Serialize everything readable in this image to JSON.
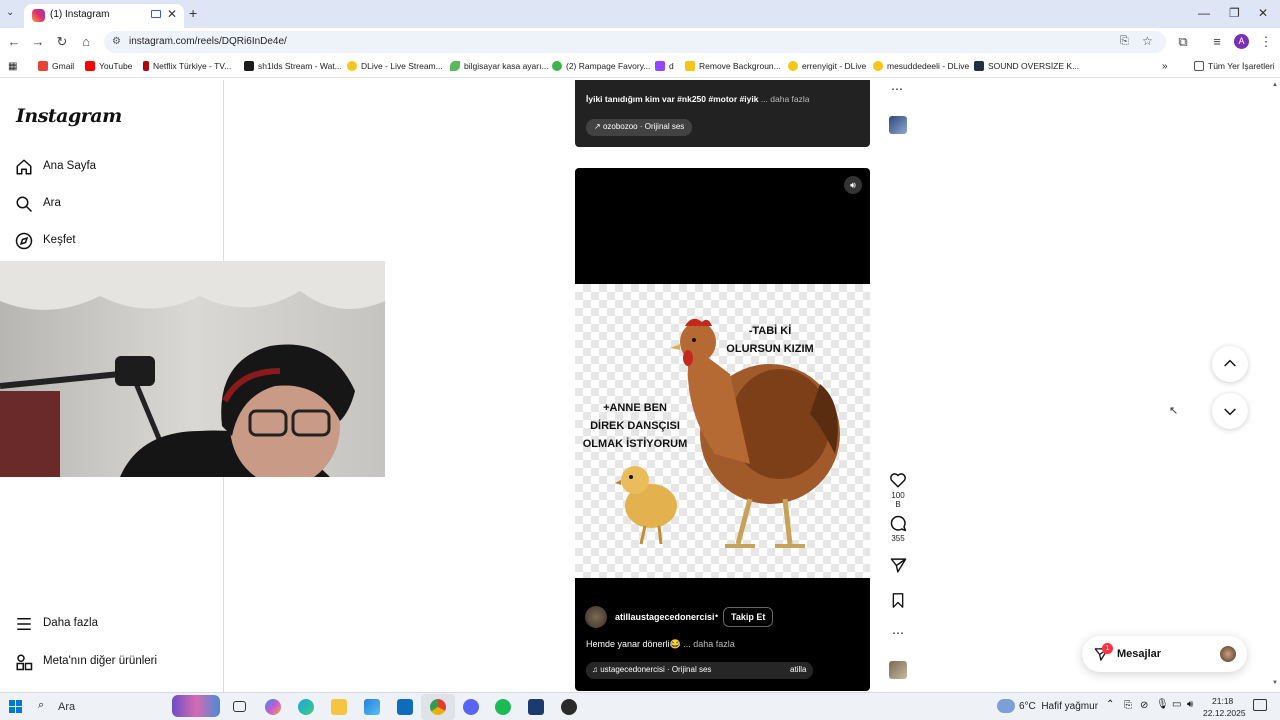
{
  "browser": {
    "tab_title": "(1) Instagram",
    "url": "instagram.com/reels/DQRi6InDe4e/",
    "bookmarks": [
      "Gmail",
      "YouTube",
      "Netflix Türkiye - TV...",
      "sh1lds Stream - Wat...",
      "DLive - Live Stream...",
      "bilgisayar kasa ayarı...",
      "(2) Rampage Favory...",
      "d",
      "Remove Backgroun...",
      "errenyigit - DLive",
      "mesuddedeeli - DLive",
      "SOUND OVERSİZE K..."
    ],
    "all_bookmarks": "Tüm Yer İşaretleri",
    "profile_initial": "A"
  },
  "sidebar": {
    "logo": "Instagram",
    "items": [
      {
        "label": "Ana Sayfa",
        "icon": "home-icon"
      },
      {
        "label": "Ara",
        "icon": "search-icon"
      },
      {
        "label": "Keşfet",
        "icon": "compass-icon"
      }
    ],
    "bottom_items": [
      {
        "label": "Daha fazla",
        "icon": "menu-icon"
      },
      {
        "label": "Meta'nın diğer ürünleri",
        "icon": "meta-apps-icon"
      }
    ]
  },
  "prev_reel": {
    "caption": "İyiki tanıdığım kim var #nk250 #motor #iyik",
    "more": "... daha fazla",
    "audio": "ozobozoo · Orijinal ses"
  },
  "reel": {
    "meme_right": [
      "-TABİ Kİ",
      "OLURSUN KIZIM"
    ],
    "meme_left": [
      "+ANNE BEN",
      "DİREK DANSÇISI",
      "OLMAK İSTİYORUM"
    ],
    "username": "atillaustagecedonercisi",
    "follow": "Takip Et",
    "caption": "Hemde yanar dönerli😂",
    "more": "... daha fazla",
    "audio": "ustagecedonercisi · Orijinal ses",
    "audio_user": "atilla",
    "likes": "100 B",
    "comments": "355"
  },
  "messages": {
    "label": "Mesajlar",
    "badge": "1"
  },
  "taskbar": {
    "search": "Ara",
    "weather": "6°C  Hafif yağmur",
    "time": "21:18",
    "date": "22.12.2025"
  }
}
